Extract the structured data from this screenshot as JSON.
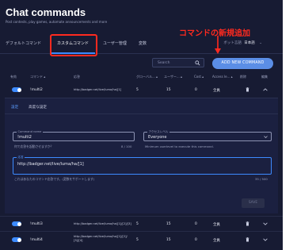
{
  "header": {
    "title": "Chat commands",
    "subtitle": "Post contests, play games, automate announcements and more"
  },
  "annotation": {
    "label": "コマンドの新規追加"
  },
  "tabs": [
    {
      "label": "デフォルトコマンド"
    },
    {
      "label": "カスタムコマンド"
    },
    {
      "label": "ユーザー管理"
    },
    {
      "label": "変数"
    }
  ],
  "bot_language": {
    "label": "ボット言語",
    "value": "日本語"
  },
  "toolbar": {
    "search_placeholder": "Search",
    "add_button": "ADD NEW COMMAND"
  },
  "table": {
    "headers": [
      "有効",
      "コマンド ▴",
      "応答",
      "グローバル... ▴",
      "ユーザー... ▴",
      "Cost ▴",
      "Access le... ▴",
      "削除",
      "編集"
    ],
    "rows": [
      {
        "command": "!multi2",
        "response": "http://badger.net/live/luma/ha/[1]",
        "global": "5",
        "user": "15",
        "cost": "0",
        "access": "全員"
      },
      {
        "command": "!multi3",
        "response": "http://badger.net/live/luma/ha/[1]/[2]/[3]",
        "global": "5",
        "user": "15",
        "cost": "0",
        "access": "全員"
      },
      {
        "command": "!multi4",
        "response": "http://badger.net/live/luma/ha/[1]/[2]/[3]/[4]",
        "global": "5",
        "user": "15",
        "cost": "0",
        "access": "全員"
      }
    ]
  },
  "editor": {
    "subtabs": [
      "設定",
      "高度な設定"
    ],
    "command_name_label": "Command name",
    "command_name_value": "!multi2",
    "command_helper": "何で応答を起動させますか？",
    "command_counter": "8 / 100",
    "access_label": "アクセスレベル",
    "access_value": "Everyone",
    "access_helper": "Minimum userlevel to execute this command.",
    "response_label": "応答",
    "response_value": "http://badger.net/live/luma/ha/[1]",
    "response_helper": "これはあなたのコマンド応答です。(変数をサポートします)",
    "response_counter": "35 / 500",
    "save_label": "SAVE"
  },
  "colors": {
    "background": "#171b33",
    "accent": "#3d8bff",
    "button": "#5b8ee6",
    "annotation": "#ff2a1f"
  }
}
